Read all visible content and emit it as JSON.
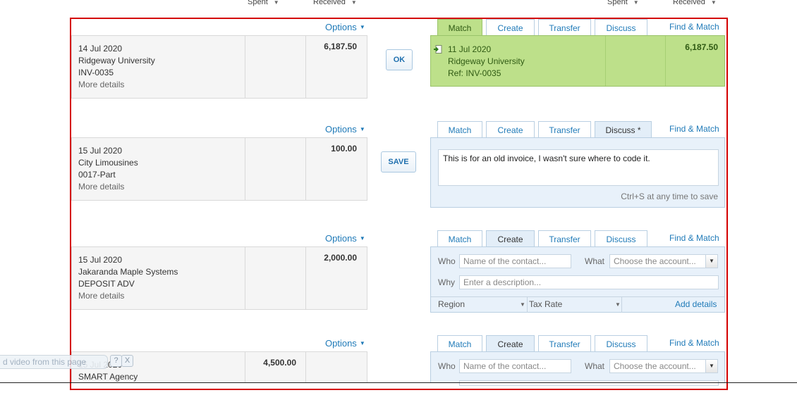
{
  "column_headers": {
    "left_spent": "Spent",
    "left_received": "Received",
    "right_spent": "Spent",
    "right_received": "Received"
  },
  "options_label": "Options",
  "tabs": {
    "match": "Match",
    "create": "Create",
    "transfer": "Transfer",
    "discuss": "Discuss",
    "discuss_edited": "Discuss *",
    "find_match": "Find & Match"
  },
  "rows": [
    {
      "date": "14 Jul 2020",
      "payee": "Ridgeway University",
      "reference": "INV-0035",
      "more": "More details",
      "spent": "",
      "received": "6,187.50",
      "action": "OK",
      "match": {
        "date": "11 Jul 2020",
        "payee": "Ridgeway University",
        "reference": "Ref: INV-0035",
        "received": "6,187.50"
      }
    },
    {
      "date": "15 Jul 2020",
      "payee": "City Limousines",
      "reference": "0017-Part",
      "more": "More details",
      "spent": "",
      "received": "100.00",
      "action": "SAVE",
      "discuss": {
        "text": "This is for an old invoice, I wasn't sure where to code it.",
        "hint": "Ctrl+S at any time to save"
      }
    },
    {
      "date": "15 Jul 2020",
      "payee": "Jakaranda Maple Systems",
      "reference": "DEPOSIT ADV",
      "more": "More details",
      "spent": "",
      "received": "2,000.00"
    },
    {
      "date": "15 Jul 2020",
      "payee": "SMART Agency",
      "spent": "4,500.00",
      "received": ""
    }
  ],
  "create_form": {
    "who_label": "Who",
    "who_placeholder": "Name of the contact...",
    "what_label": "What",
    "what_placeholder": "Choose the account...",
    "why_label": "Why",
    "why_placeholder": "Enter a description...",
    "region_label": "Region",
    "tax_rate_label": "Tax Rate",
    "add_details": "Add details"
  },
  "video_popup": {
    "text": "d video from this page",
    "help": "?",
    "close": "X"
  }
}
